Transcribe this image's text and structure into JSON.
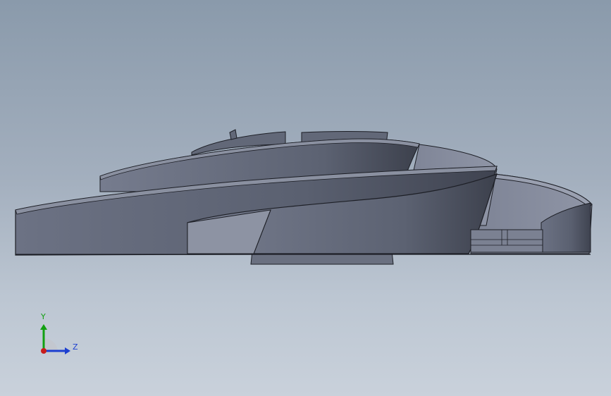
{
  "viewport": {
    "background_top": "#8a9aab",
    "background_bottom": "#c9d1db",
    "model_fill": "#5e6474",
    "model_shadow": "#474c59",
    "model_highlight": "#8a90a0",
    "edge_color": "#1d1f26"
  },
  "triad": {
    "y_label": "Y",
    "z_label": "Z",
    "y_color": "#11a011",
    "z_color": "#1c3fd0",
    "x_color": "#c81c1c"
  }
}
